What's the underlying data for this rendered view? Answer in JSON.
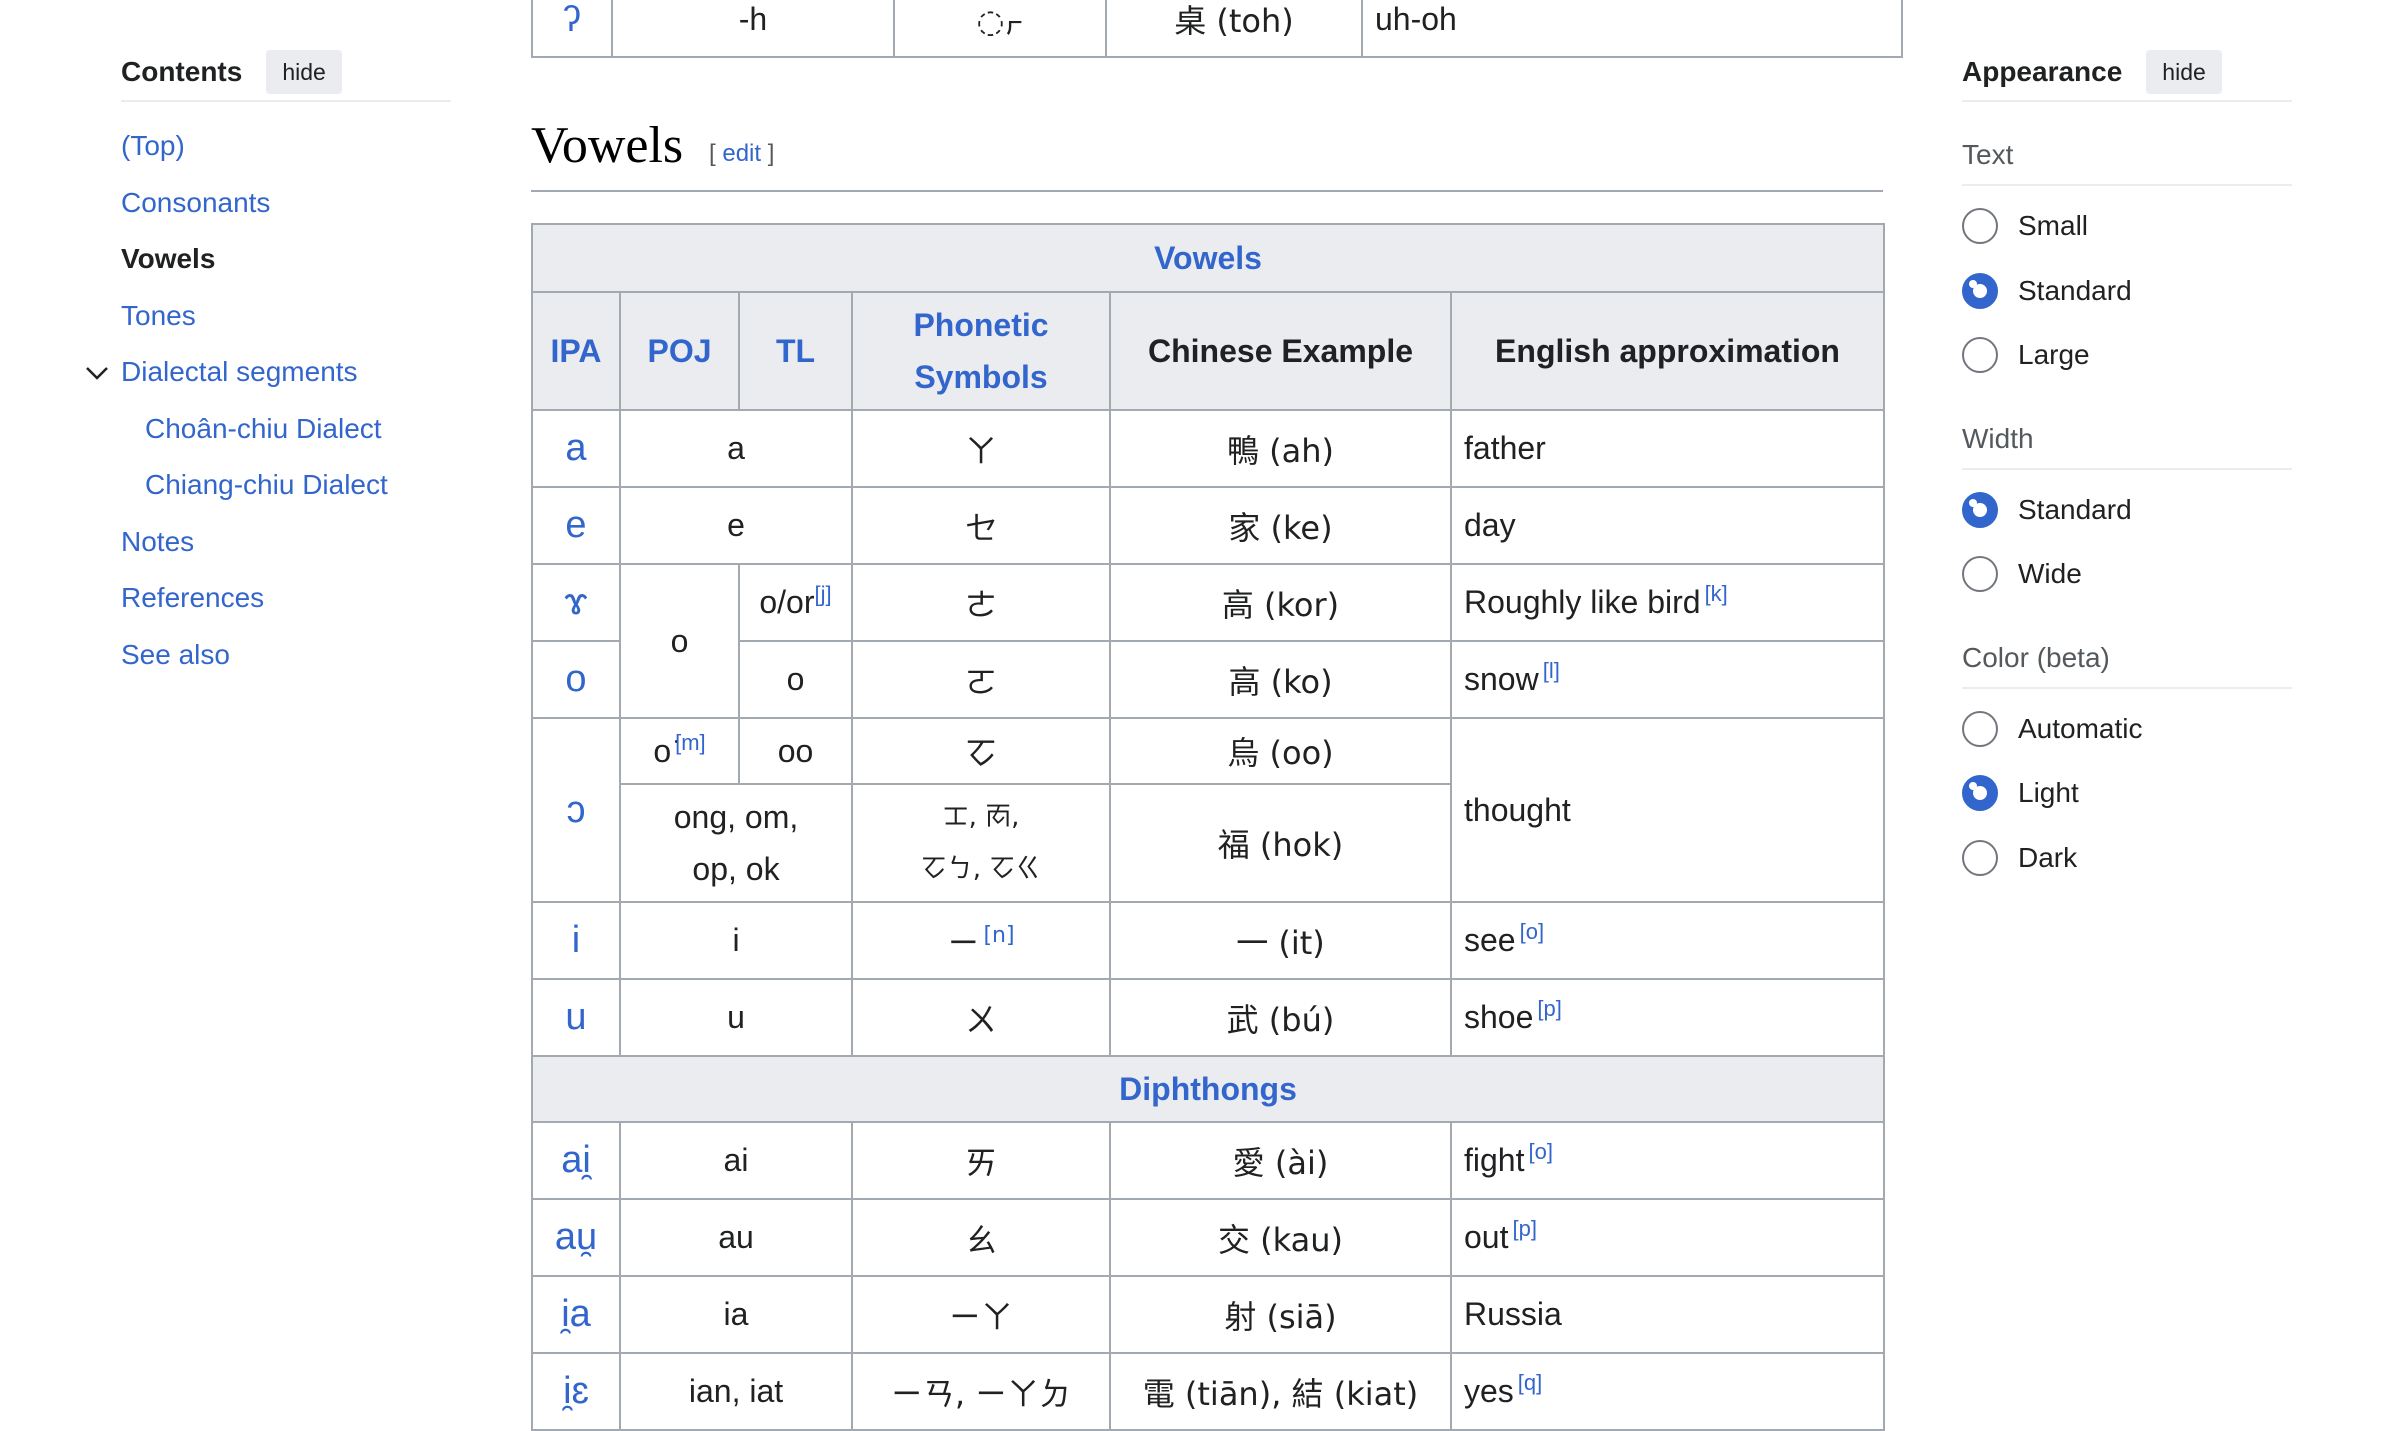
{
  "toc": {
    "title": "Contents",
    "hide": "hide",
    "items": [
      {
        "label": "(Top)"
      },
      {
        "label": "Consonants"
      },
      {
        "label": "Vowels"
      },
      {
        "label": "Tones"
      },
      {
        "label": "Dialectal segments"
      },
      {
        "label": "Choân-chiu Dialect"
      },
      {
        "label": "Chiang-chiu Dialect"
      },
      {
        "label": "Notes"
      },
      {
        "label": "References"
      },
      {
        "label": "See also"
      }
    ]
  },
  "appearance": {
    "title": "Appearance",
    "hide": "hide",
    "text_label": "Text",
    "text_options": [
      "Small",
      "Standard",
      "Large"
    ],
    "width_label": "Width",
    "width_options": [
      "Standard",
      "Wide"
    ],
    "color_label": "Color (beta)",
    "color_options": [
      "Automatic",
      "Light",
      "Dark"
    ]
  },
  "top_row": {
    "ipa": "ʔ",
    "poj": "-h",
    "phon": "◌ㆷ",
    "example": "桌 (toh)",
    "eng": "uh-oh"
  },
  "heading": {
    "title": "Vowels",
    "edit": "edit"
  },
  "table": {
    "caption": "Vowels",
    "headers": [
      "IPA",
      "POJ",
      "TL",
      "Phonetic Symbols",
      "Chinese Example",
      "English approximation"
    ],
    "diphthongs_caption": "Diphthongs",
    "rows": {
      "a": {
        "ipa": "a",
        "poj": "a",
        "phon": "ㄚ",
        "ex": "鴨 (ah)",
        "eng": "father"
      },
      "e": {
        "ipa": "e",
        "poj": "e",
        "phon": "ㆤ",
        "ex": "家 (ke)",
        "eng": "day"
      },
      "ɤ": {
        "ipa": "ɤ",
        "poj": "o",
        "tl": "o/or",
        "tl_ref": "[j]",
        "phon": "ㄜ",
        "ex": "高 (kor)",
        "eng": "Roughly like bird",
        "ref": "[k]"
      },
      "o": {
        "ipa": "o",
        "tl": "o",
        "phon": "ㄛ",
        "ex": "高 (ko)",
        "eng": "snow",
        "ref": "[l]"
      },
      "ɔ": {
        "ipa": "ɔ",
        "poj": "o͘",
        "poj_ref": "[m]",
        "tl": "oo",
        "phon": "ㆦ",
        "ex": "烏 (oo)",
        "eng": "thought",
        "poj2a": "ong, om,",
        "poj2b": "op, ok",
        "phon2a": "ㆲ, ㆱ,",
        "phon2b": "ㆦㄅ, ㆦㄍ",
        "ex2": "福 (hok)"
      },
      "i": {
        "ipa": "i",
        "poj": "i",
        "phon": "ㄧ",
        "phon_ref": "[n]",
        "ex": "一 (it)",
        "eng": "see",
        "ref": "[o]"
      },
      "u": {
        "ipa": "u",
        "poj": "u",
        "phon": "ㄨ",
        "ex": "武 (bú)",
        "eng": "shoe",
        "ref": "[p]"
      },
      "ai": {
        "ipa": "ai̯",
        "poj": "ai",
        "phon": "ㄞ",
        "ex": "愛 (ài)",
        "eng": "fight",
        "ref": "[o]"
      },
      "au": {
        "ipa": "au̯",
        "poj": "au",
        "phon": "ㄠ",
        "ex": "交 (kau)",
        "eng": "out",
        "ref": "[p]"
      },
      "ia": {
        "ipa": "i̯a",
        "poj": "ia",
        "phon": "ㄧㄚ",
        "ex": "射 (siā)",
        "eng": "Russia"
      },
      "ie": {
        "ipa": "i̯ɛ",
        "poj": "ian, iat",
        "phon": "ㄧㄢ, ㄧㄚㄉ",
        "ex": "電 (tiān), 結 (kiat)",
        "eng": "yes",
        "ref": "[q]"
      }
    }
  }
}
